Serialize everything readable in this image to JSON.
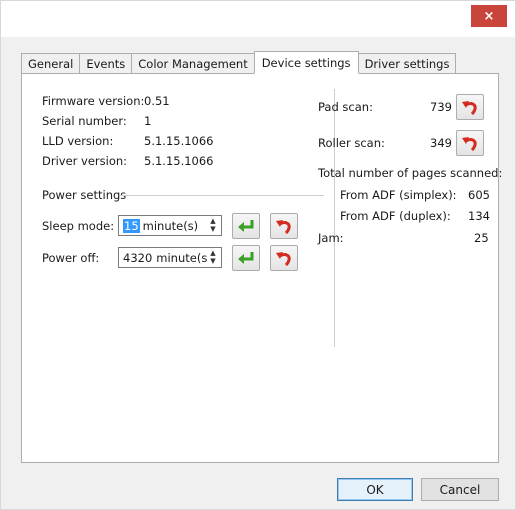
{
  "window": {
    "close_glyph": "×"
  },
  "tabs": [
    {
      "label": "General"
    },
    {
      "label": "Events"
    },
    {
      "label": "Color Management"
    },
    {
      "label": "Device settings",
      "active": true
    },
    {
      "label": "Driver settings"
    }
  ],
  "info": {
    "firmware_label": "Firmware version:",
    "firmware_value": "0.51",
    "serial_label": "Serial number:",
    "serial_value": "1",
    "lld_label": "LLD version:",
    "lld_value": "5.1.15.1066",
    "driver_label": "Driver version:",
    "driver_value": "5.1.15.1066"
  },
  "power": {
    "group_label": "Power settings",
    "sleep_label": "Sleep mode:",
    "sleep_value": "15",
    "sleep_unit": "minute(s)",
    "poweroff_label": "Power off:",
    "poweroff_value": "4320",
    "poweroff_unit": "minute(s"
  },
  "counters": {
    "pad_label": "Pad scan:",
    "pad_value": "739",
    "roller_label": "Roller scan:",
    "roller_value": "349",
    "total_label": "Total number of pages scanned:",
    "adf_simplex_label": "From ADF (simplex):",
    "adf_simplex_value": "605",
    "adf_duplex_label": "From ADF (duplex):",
    "adf_duplex_value": "134",
    "jam_label": "Jam:",
    "jam_value": "25"
  },
  "footer": {
    "ok_label": "OK",
    "cancel_label": "Cancel"
  },
  "colors": {
    "apply_icon": "#3aa02a",
    "reset_icon": "#d42a1f",
    "close_bg": "#c9443b"
  },
  "icons": {
    "apply": "green-enter-arrow-icon",
    "reset": "red-undo-arrow-icon"
  }
}
